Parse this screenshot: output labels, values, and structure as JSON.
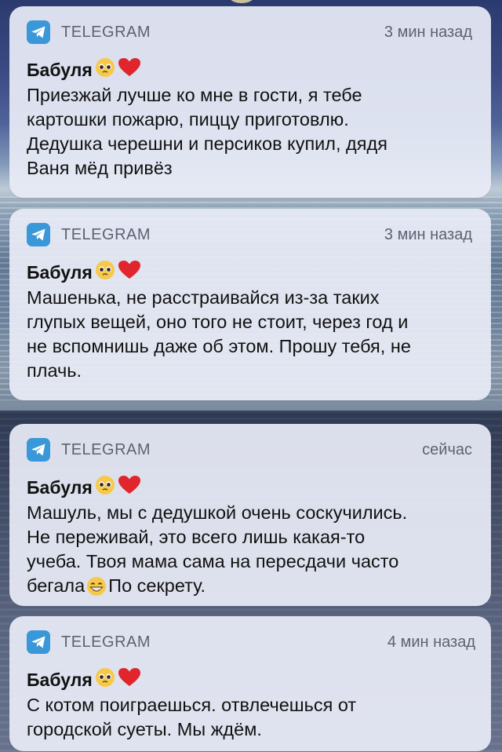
{
  "notifications": [
    {
      "app": "TELEGRAM",
      "time": "3 мин назад",
      "sender": "Бабуля",
      "sender_emojis": [
        "pleading-face",
        "red-heart"
      ],
      "lines": [
        "Приезжай лучше ко мне в гости, я тебе",
        "картошки пожарю, пиццу приготовлю.",
        "Дедушка черешни и персиков купил, дядя",
        "Ваня мёд привёз"
      ]
    },
    {
      "app": "TELEGRAM",
      "time": "3 мин назад",
      "sender": "Бабуля",
      "sender_emojis": [
        "pleading-face",
        "red-heart"
      ],
      "lines": [
        "Машенька, не расстраивайся из-за таких",
        "глупых вещей, оно того не стоит, через год и",
        "не вспомнишь даже об этом. Прошу тебя, не",
        "плачь."
      ]
    },
    {
      "app": "TELEGRAM",
      "time": "сейчас",
      "sender": "Бабуля",
      "sender_emojis": [
        "pleading-face",
        "red-heart"
      ],
      "lines": [
        "Машуль, мы с дедушкой очень соскучились.",
        "Не переживай, это всего лишь какая-то",
        "учеба. Твоя мама сама на пересдачи часто"
      ],
      "last_line_before": "бегала",
      "last_line_emoji": "grinning-face",
      "last_line_after": "По секрету."
    },
    {
      "app": "TELEGRAM",
      "time": "4 мин назад",
      "sender": "Бабуля",
      "sender_emojis": [
        "pleading-face",
        "red-heart"
      ],
      "lines": [
        "С котом поиграешься. отвлечешься от",
        "городской суеты. Мы ждём."
      ]
    }
  ],
  "colors": {
    "card_bg": "#e8ecf6",
    "telegram_blue": "#3a98d8",
    "meta_text": "#5d6274",
    "body_text": "#111111"
  }
}
